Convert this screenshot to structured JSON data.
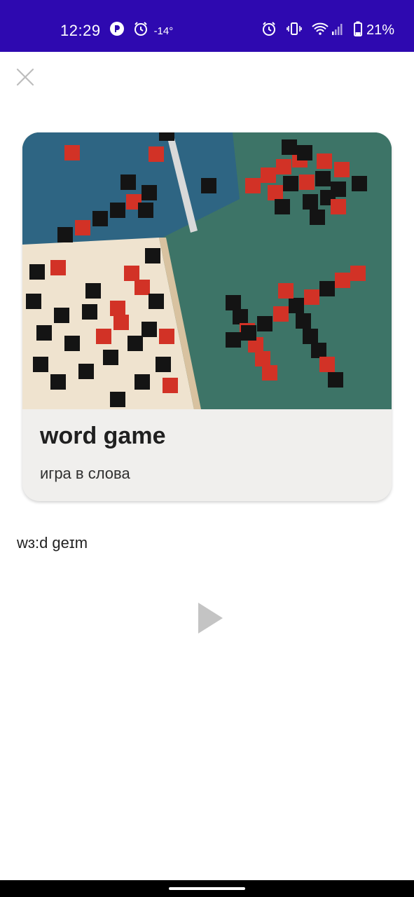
{
  "status_bar": {
    "time": "12:29",
    "temperature": "-14°",
    "battery_percent": "21%",
    "background_color": "#2e09b0",
    "icons": [
      "app-notification-icon",
      "alarm-icon",
      "alarm-icon",
      "vibrate-icon",
      "wifi-icon",
      "signal-icon",
      "battery-icon"
    ],
    "battery_level": 0.21
  },
  "toolbar": {
    "close_icon": "close-icon"
  },
  "card": {
    "image_icon": "word-game-photo",
    "title": "word game",
    "translation": "игра в слова",
    "background_color": "#f0efed"
  },
  "transcription": "wɜ:d geɪm",
  "player": {
    "play_icon": "play-icon",
    "color": "#c4c4c4"
  }
}
